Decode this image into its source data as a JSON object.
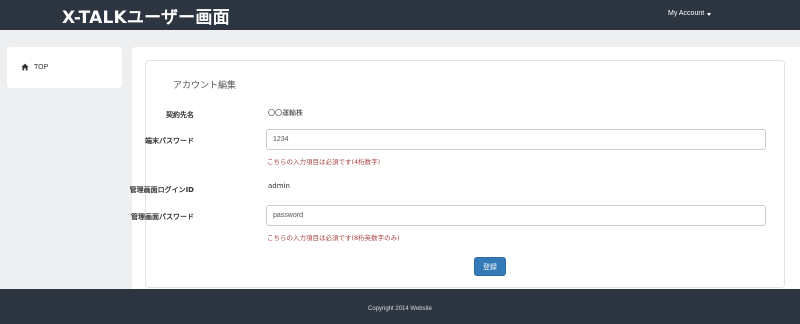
{
  "header": {
    "brand": "X-TALKユーザー画面",
    "account_label": "My Account"
  },
  "sidebar": {
    "items": [
      {
        "label": "TOP",
        "icon": "home-icon"
      }
    ]
  },
  "form": {
    "title": "アカウント編集",
    "fields": [
      {
        "label": "契約先名",
        "value": "〇〇運輸株"
      },
      {
        "label": "端末パスワード",
        "value": "1234",
        "help": "こちらの入力項目は必須です(4桁数字)"
      },
      {
        "label": "管理画面ログインID",
        "value": "admin"
      },
      {
        "label": "管理画面パスワード",
        "value": "password",
        "help": "こちらの入力項目は必須です(8桁英数字のみ)"
      }
    ],
    "submit_label": "登録"
  },
  "footer": {
    "copyright": "Copyright 2014 Website"
  },
  "colors": {
    "navbar": "#2c3540",
    "primary_button": "#337ab7",
    "help_text": "#a94442",
    "page_background": "#eeeff1"
  }
}
